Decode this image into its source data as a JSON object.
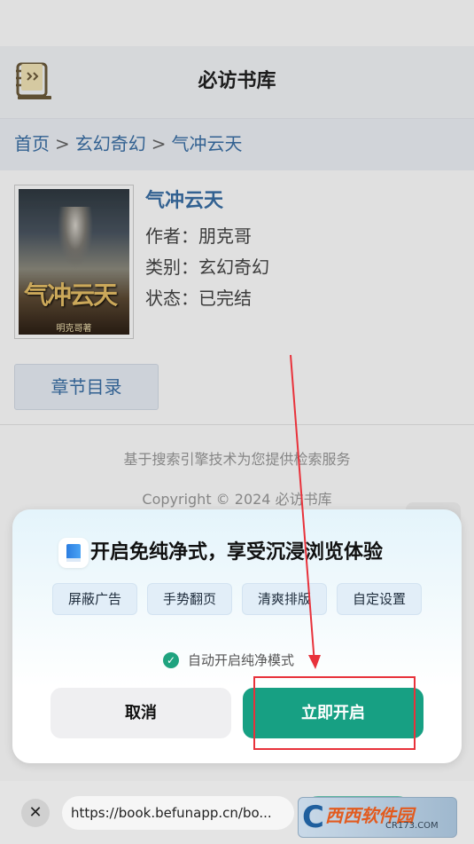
{
  "header": {
    "title": "必访书库",
    "logo_icon": "notebook-icon"
  },
  "breadcrumb": {
    "home": "首页",
    "separator": ">",
    "category": "玄幻奇幻",
    "current": "气冲云天"
  },
  "book": {
    "cover_title": "气冲云天",
    "cover_author": "明克哥著",
    "title": "气冲云天",
    "author_line": "作者：朋克哥",
    "category_line": "类别：玄幻奇幻",
    "status_line": "状态：已完结",
    "toc_button": "章节目录"
  },
  "footer": {
    "tagline": "基于搜索引擎技术为您提供检索服务",
    "copyright": "Copyright © 2024 必访书库"
  },
  "dialog": {
    "title": "开启免纯净式，享受沉浸浏览体验",
    "tags": [
      "屏蔽广告",
      "手势翻页",
      "清爽排版",
      "自定设置"
    ],
    "auto_label": "自动开启纯净模式",
    "cancel": "取消",
    "confirm": "立即开启",
    "accent_color": "#17a083",
    "annotation_color": "#e8323b"
  },
  "bottom_bar": {
    "url": "https://book.befunapp.cn/bo..."
  },
  "watermark": {
    "main": "西西软件园",
    "sub": "CR173.COM"
  }
}
